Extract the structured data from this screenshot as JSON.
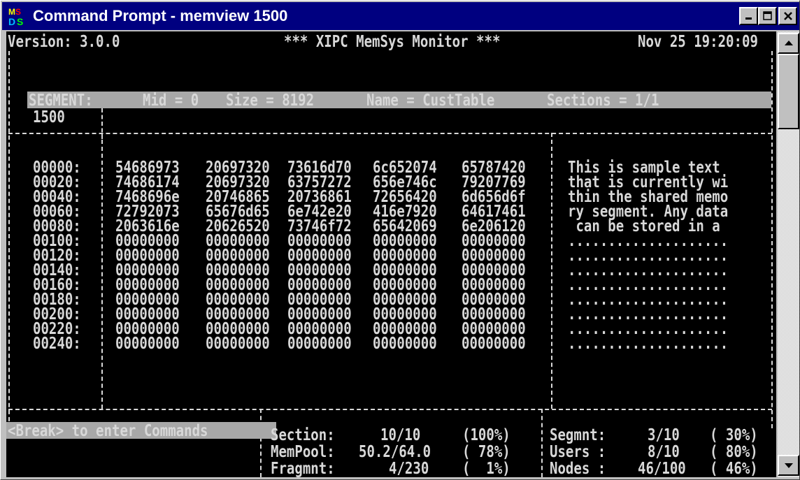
{
  "window": {
    "title": "Command Prompt - memview 1500"
  },
  "header": {
    "version": "Version: 3.0.0",
    "banner": "*** XIPC MemSys Monitor ***",
    "datetime": "Nov 25 19:20:09"
  },
  "segment": {
    "label": "SEGMENT:",
    "mid": "Mid = 0",
    "size": "Size = 8192",
    "name": "Name = CustTable",
    "sections": "Sections = 1/1",
    "id": "1500"
  },
  "dump": {
    "rows": [
      {
        "offset": "00000:",
        "words": [
          "54686973",
          "20697320",
          "73616d70",
          "6c652074",
          "65787420"
        ],
        "ascii": "This is sample text"
      },
      {
        "offset": "00020:",
        "words": [
          "74686174",
          "20697320",
          "63757272",
          "656e746c",
          "79207769"
        ],
        "ascii": "that is currently wi"
      },
      {
        "offset": "00040:",
        "words": [
          "7468696e",
          "20746865",
          "20736861",
          "72656420",
          "6d656d6f"
        ],
        "ascii": "thin the shared memo"
      },
      {
        "offset": "00060:",
        "words": [
          "72792073",
          "65676d65",
          "6e742e20",
          "416e7920",
          "64617461"
        ],
        "ascii": "ry segment. Any data"
      },
      {
        "offset": "00080:",
        "words": [
          "2063616e",
          "20626520",
          "73746f72",
          "65642069",
          "6e206120"
        ],
        "ascii": " can be stored in a"
      },
      {
        "offset": "00100:",
        "words": [
          "00000000",
          "00000000",
          "00000000",
          "00000000",
          "00000000"
        ],
        "ascii": "...................."
      },
      {
        "offset": "00120:",
        "words": [
          "00000000",
          "00000000",
          "00000000",
          "00000000",
          "00000000"
        ],
        "ascii": "...................."
      },
      {
        "offset": "00140:",
        "words": [
          "00000000",
          "00000000",
          "00000000",
          "00000000",
          "00000000"
        ],
        "ascii": "...................."
      },
      {
        "offset": "00160:",
        "words": [
          "00000000",
          "00000000",
          "00000000",
          "00000000",
          "00000000"
        ],
        "ascii": "...................."
      },
      {
        "offset": "00180:",
        "words": [
          "00000000",
          "00000000",
          "00000000",
          "00000000",
          "00000000"
        ],
        "ascii": "...................."
      },
      {
        "offset": "00200:",
        "words": [
          "00000000",
          "00000000",
          "00000000",
          "00000000",
          "00000000"
        ],
        "ascii": "...................."
      },
      {
        "offset": "00220:",
        "words": [
          "00000000",
          "00000000",
          "00000000",
          "00000000",
          "00000000"
        ],
        "ascii": "...................."
      },
      {
        "offset": "00240:",
        "words": [
          "00000000",
          "00000000",
          "00000000",
          "00000000",
          "00000000"
        ],
        "ascii": "...................."
      }
    ]
  },
  "footer": {
    "command_hint": "<Break> to enter Commands",
    "stats_left": [
      {
        "label": "Section:",
        "value": "10/10",
        "pct": "(100%)"
      },
      {
        "label": "MemPool:",
        "value": "50.2/64.0",
        "pct": "( 78%)"
      },
      {
        "label": "Fragmnt:",
        "value": "4/230",
        "pct": "(  1%)"
      }
    ],
    "stats_right": [
      {
        "label": "Segmnt:",
        "value": "3/10",
        "pct": "( 30%)"
      },
      {
        "label": "Users :",
        "value": "8/10",
        "pct": "( 80%)"
      },
      {
        "label": "Nodes :",
        "value": "46/100",
        "pct": "( 46%)"
      }
    ]
  },
  "icons": {
    "app": "ms-dos-icon",
    "minimize": "minimize-icon",
    "maximize": "maximize-icon",
    "close": "close-icon",
    "scroll_up": "arrow-up-icon",
    "scroll_down": "arrow-down-icon"
  }
}
